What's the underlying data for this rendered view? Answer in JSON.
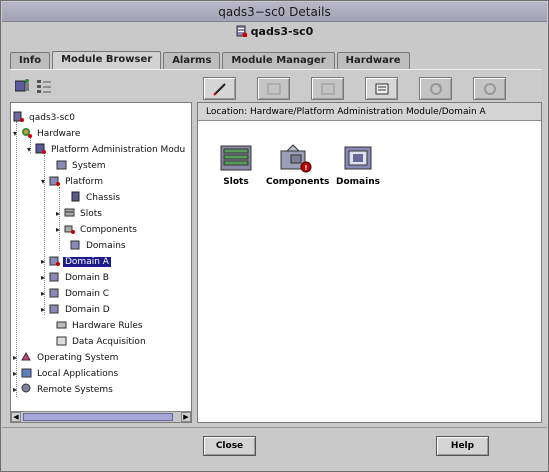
{
  "window": {
    "title": "qads3−sc0 Details",
    "subtitle": "qads3-sc0"
  },
  "tabs": [
    {
      "label": "Info"
    },
    {
      "label": "Module Browser"
    },
    {
      "label": "Alarms"
    },
    {
      "label": "Module Manager"
    },
    {
      "label": "Hardware"
    }
  ],
  "toolbar": {
    "buttons": [
      {
        "icon": "edit-pencil-icon"
      },
      {
        "icon": "blank-icon"
      },
      {
        "icon": "blank-icon"
      },
      {
        "icon": "properties-icon"
      },
      {
        "icon": "refresh-icon"
      },
      {
        "icon": "reload-icon"
      }
    ]
  },
  "tree": {
    "root": "qads3-sc0",
    "hardware": "Hardware",
    "pam": "Platform Administration Modu",
    "system": "System",
    "platform": "Platform",
    "chassis": "Chassis",
    "slots": "Slots",
    "components": "Components",
    "domains": "Domains",
    "domain_a": "Domain A",
    "domain_b": "Domain B",
    "domain_c": "Domain C",
    "domain_d": "Domain D",
    "hardware_rules": "Hardware Rules",
    "data_acquisition": "Data Acquisition",
    "operating_system": "Operating System",
    "local_apps": "Local Applications",
    "remote_systems": "Remote Systems"
  },
  "location": {
    "text": "Location:  Hardware/Platform Administration Module/Domain A"
  },
  "items": [
    {
      "label": "Slots"
    },
    {
      "label": "Components"
    },
    {
      "label": "Domains"
    }
  ],
  "buttons": {
    "close": "Close",
    "help": "Help"
  },
  "colors": {
    "selection": "#1c1c8c",
    "alarm": "#c80000",
    "scroll_thumb": "#a6a6d8"
  }
}
